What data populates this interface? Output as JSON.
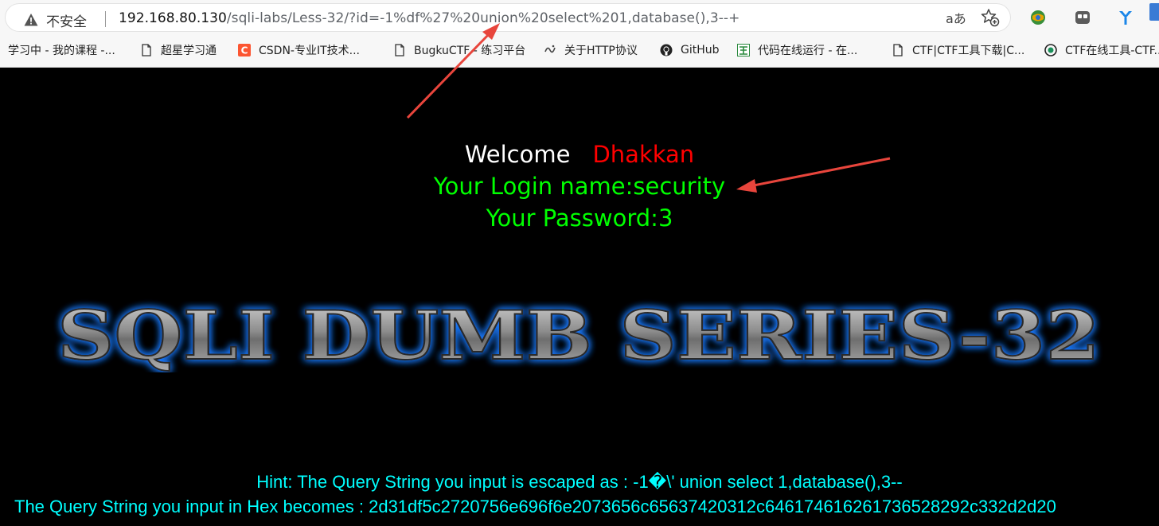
{
  "browser": {
    "security_label": "不安全",
    "url_host": "192.168.80.130",
    "url_rest": "/sqli-labs/Less-32/?id=-1%df%27%20union%20select%201,database(),3--+",
    "reader_icon": "aあ",
    "icons": [
      "warning-icon",
      "reader-mode-icon",
      "add-favorite-icon",
      "extension-icon",
      "extension-icon",
      "extension-icon"
    ]
  },
  "bookmarks": [
    {
      "label": "学习中 - 我的课程 -...",
      "icon": "none"
    },
    {
      "label": "超星学习通",
      "icon": "page-icon"
    },
    {
      "label": "CSDN-专业IT技术...",
      "icon": "csdn-icon"
    },
    {
      "label": "BugkuCTF - 练习平台",
      "icon": "page-icon"
    },
    {
      "label": "关于HTTP协议",
      "icon": "om-icon"
    },
    {
      "label": "GitHub",
      "icon": "github-icon"
    },
    {
      "label": "代码在线运行 - 在...",
      "icon": "code-icon"
    },
    {
      "label": "CTF|CTF工具下载|C...",
      "icon": "page-icon"
    },
    {
      "label": "CTF在线工具-CTF...",
      "icon": "ctf-icon"
    }
  ],
  "page": {
    "welcome": "Welcome",
    "name": "Dhakkan",
    "login_name": "Your Login name:security",
    "password": "Your Password:3",
    "banner": "SQLI DUMB SERIES-32",
    "hint": "Hint: The Query String you input is escaped as : -1�\\' union select 1,database(),3--",
    "hex": "The Query String you input in Hex becomes : 2d31df5c2720756e696f6e2073656c65637420312c646174616261736528292c332d2d20"
  },
  "colors": {
    "welcome": "#ffffff",
    "name": "#ff0000",
    "login": "#00ff00",
    "hint": "#00ffff",
    "banner_glow": "#1e7bff",
    "annotation_arrow": "#e8453c"
  }
}
